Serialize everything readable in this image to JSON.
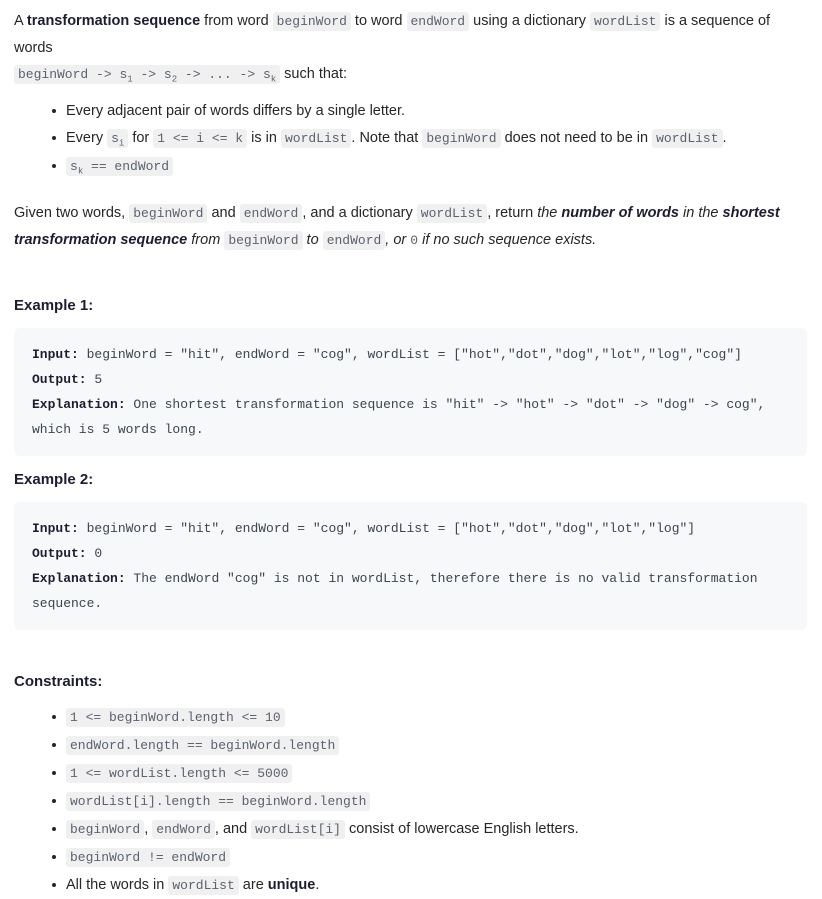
{
  "intro": {
    "lead_a": "A ",
    "lead_bold": "transformation sequence",
    "lead_b": " from word ",
    "code_beginWord": "beginWord",
    "lead_c": " to word ",
    "code_endWord": "endWord",
    "lead_d": " using a dictionary ",
    "code_wordList": "wordList",
    "lead_e": " is a sequence of words",
    "seq_begin": "beginWord",
    "seq_arrow": " -> ",
    "seq_s": "s",
    "seq_sub1": "1",
    "seq_sub2": "2",
    "seq_dots": "...",
    "seq_subk": "k",
    "lead_f": " such that:"
  },
  "rules": {
    "rule1": "Every adjacent pair of words differs by a single letter.",
    "rule2_a": "Every ",
    "rule2_s": "s",
    "rule2_sub": "i",
    "rule2_b": " for ",
    "rule2_range": "1 <= i <= k",
    "rule2_c": " is in ",
    "rule2_wordList": "wordList",
    "rule2_d": ". Note that ",
    "rule2_beginWord": "beginWord",
    "rule2_e": " does not need to be in ",
    "rule2_wordList2": "wordList",
    "rule2_f": ".",
    "rule3_s": "s",
    "rule3_sub": "k",
    "rule3_eq": " == endWord"
  },
  "given": {
    "a": "Given two words, ",
    "code_beginWord": "beginWord",
    "b": " and ",
    "code_endWord": "endWord",
    "c": ", and a dictionary ",
    "code_wordList": "wordList",
    "d": ", return ",
    "em1": "the ",
    "strong1": "number of words",
    "em2": " in the ",
    "strong2": "shortest transformation sequence",
    "em3": " from ",
    "code_beginWord2": "beginWord",
    "em4": " to ",
    "code_endWord2": "endWord",
    "em5": ", or ",
    "code_zero": "0",
    "em6": " if no such sequence exists."
  },
  "example1": {
    "heading": "Example 1:",
    "input_label": "Input:",
    "input_value": " beginWord = \"hit\", endWord = \"cog\", wordList = [\"hot\",\"dot\",\"dog\",\"lot\",\"log\",\"cog\"]",
    "output_label": "Output:",
    "output_value": " 5",
    "explanation_label": "Explanation:",
    "explanation_value": " One shortest transformation sequence is \"hit\" -> \"hot\" -> \"dot\" -> \"dog\" -> cog\", which is 5 words long."
  },
  "example2": {
    "heading": "Example 2:",
    "input_label": "Input:",
    "input_value": " beginWord = \"hit\", endWord = \"cog\", wordList = [\"hot\",\"dot\",\"dog\",\"lot\",\"log\"]",
    "output_label": "Output:",
    "output_value": " 0",
    "explanation_label": "Explanation:",
    "explanation_value": " The endWord \"cog\" is not in wordList, therefore there is no valid transformation sequence."
  },
  "constraints": {
    "heading": "Constraints:",
    "c1": "1 <= beginWord.length <= 10",
    "c2": "endWord.length == beginWord.length",
    "c3": "1 <= wordList.length <= 5000",
    "c4": "wordList[i].length == beginWord.length",
    "c5_beginWord": "beginWord",
    "c5_comma1": ", ",
    "c5_endWord": "endWord",
    "c5_comma2": ", and ",
    "c5_wordListI": "wordList[i]",
    "c5_tail": " consist of lowercase English letters.",
    "c6": "beginWord != endWord",
    "c7_a": "All the words in ",
    "c7_wordList": "wordList",
    "c7_b": " are ",
    "c7_bold": "unique",
    "c7_c": "."
  },
  "colors": {
    "text": "#262626",
    "heading": "#1d1d32",
    "inline_code_bg": "#f0f0f0",
    "inline_code_fg": "#5a6270",
    "code_block_bg": "#f7f8fa",
    "code_block_fg": "#3c4450",
    "page_bg": "#ffffff"
  }
}
